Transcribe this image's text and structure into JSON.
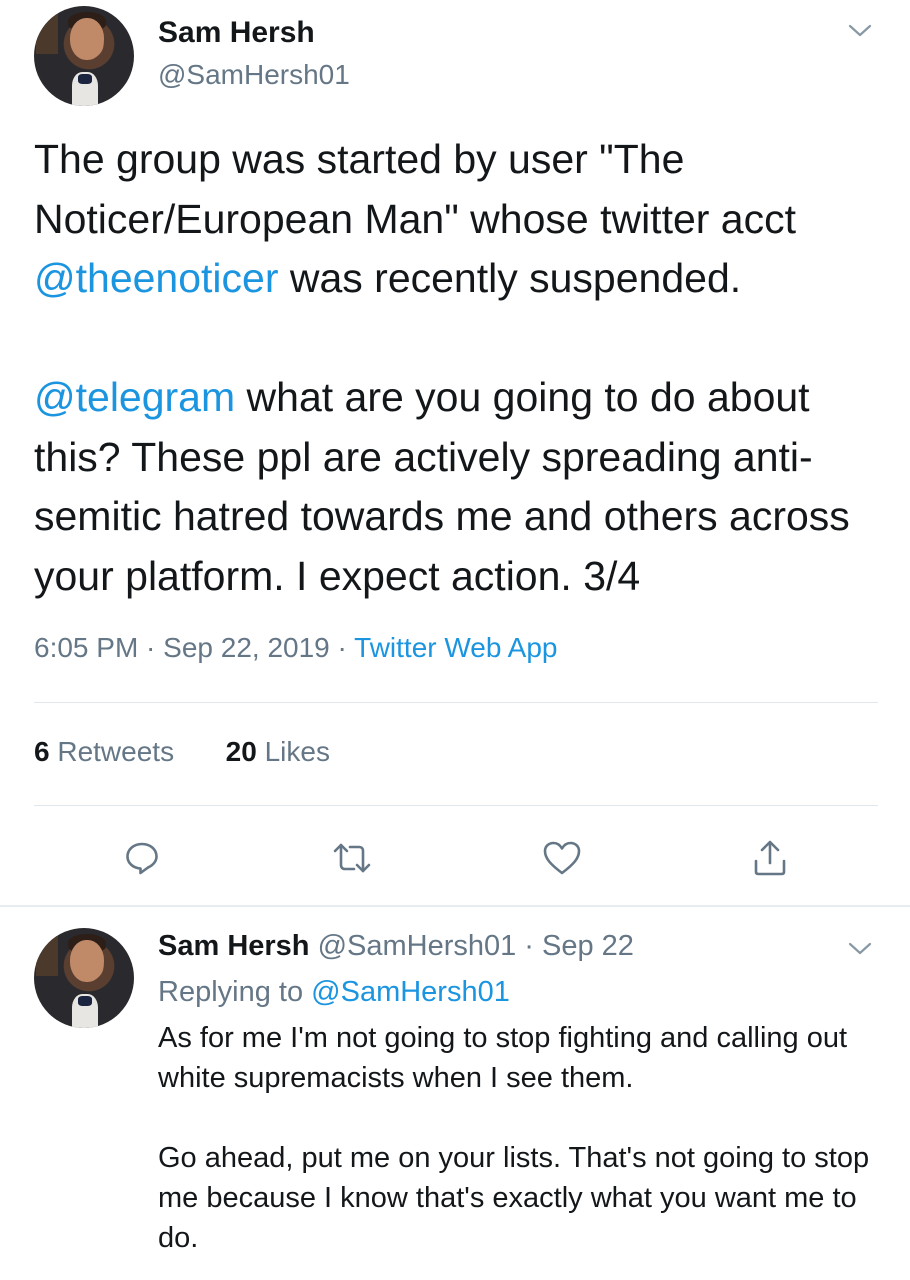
{
  "main_tweet": {
    "author_name": "Sam Hersh",
    "author_handle": "@SamHersh01",
    "text_part1": "The group was started by user \"The Noticer/European Man\" whose twitter acct ",
    "mention1": "@theenoticer",
    "text_part2": " was recently suspended.\n\n",
    "mention2": "@telegram",
    "text_part3": " what are you going to do about this? These ppl are actively spreading anti-semitic hatred towards me and others across your platform. I expect action. 3/4",
    "time_date": "6:05 PM · Sep 22, 2019 · ",
    "source": "Twitter Web App",
    "retweet_count": "6",
    "retweet_label": " Retweets",
    "like_count": "20",
    "like_label": " Likes"
  },
  "reply_tweet": {
    "author_name": "Sam Hersh",
    "author_meta": " @SamHersh01 · Sep 22",
    "replying_label": "Replying to ",
    "replying_to": "@SamHersh01",
    "text": "As for me I'm not going to stop fighting and calling out white supremacists when I see them.\n\nGo ahead, put me on your lists. That's not going to stop me because I know that's exactly what you want me to do."
  },
  "colors": {
    "link": "#1b95e0",
    "secondary_text": "#657786",
    "primary_text": "#14171a",
    "divider": "#e1e8ed"
  },
  "icons": [
    "chevron-down-icon",
    "reply-icon",
    "retweet-icon",
    "like-icon",
    "share-icon"
  ]
}
